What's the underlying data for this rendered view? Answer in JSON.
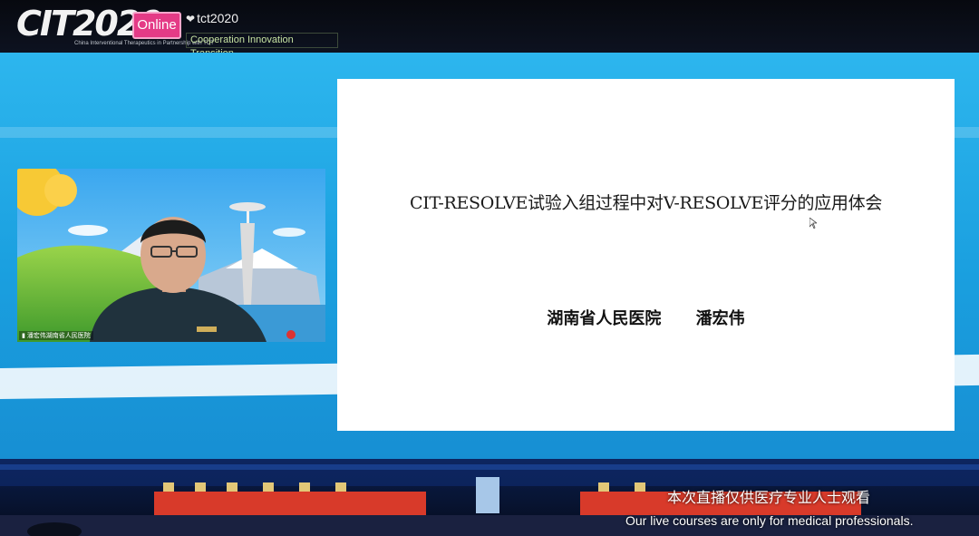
{
  "header": {
    "logo_text": "CIT2020",
    "logo_subtitle": "China Interventional Therapeutics in Partnership with TCT",
    "badge_label": "Online",
    "partner_logo": "tct2020",
    "tagline": "Cooperation Innovation Transition"
  },
  "webcam": {
    "speaker_label": "潘宏伟湖南省人民医院",
    "icon": "signal-bars-icon"
  },
  "slide": {
    "title": "CIT-RESOLVE试验入组过程中对V-RESOLVE评分的应用体会",
    "hospital": "湖南省人民医院",
    "presenter": "潘宏伟"
  },
  "notice": {
    "chinese": "本次直播仅供医疗专业人士观看",
    "english": "Our live courses are only for medical professionals."
  },
  "colors": {
    "stage_blue": "#2db6ee",
    "badge_pink": "#e43b86",
    "tagline_green": "#c6e2a2"
  }
}
